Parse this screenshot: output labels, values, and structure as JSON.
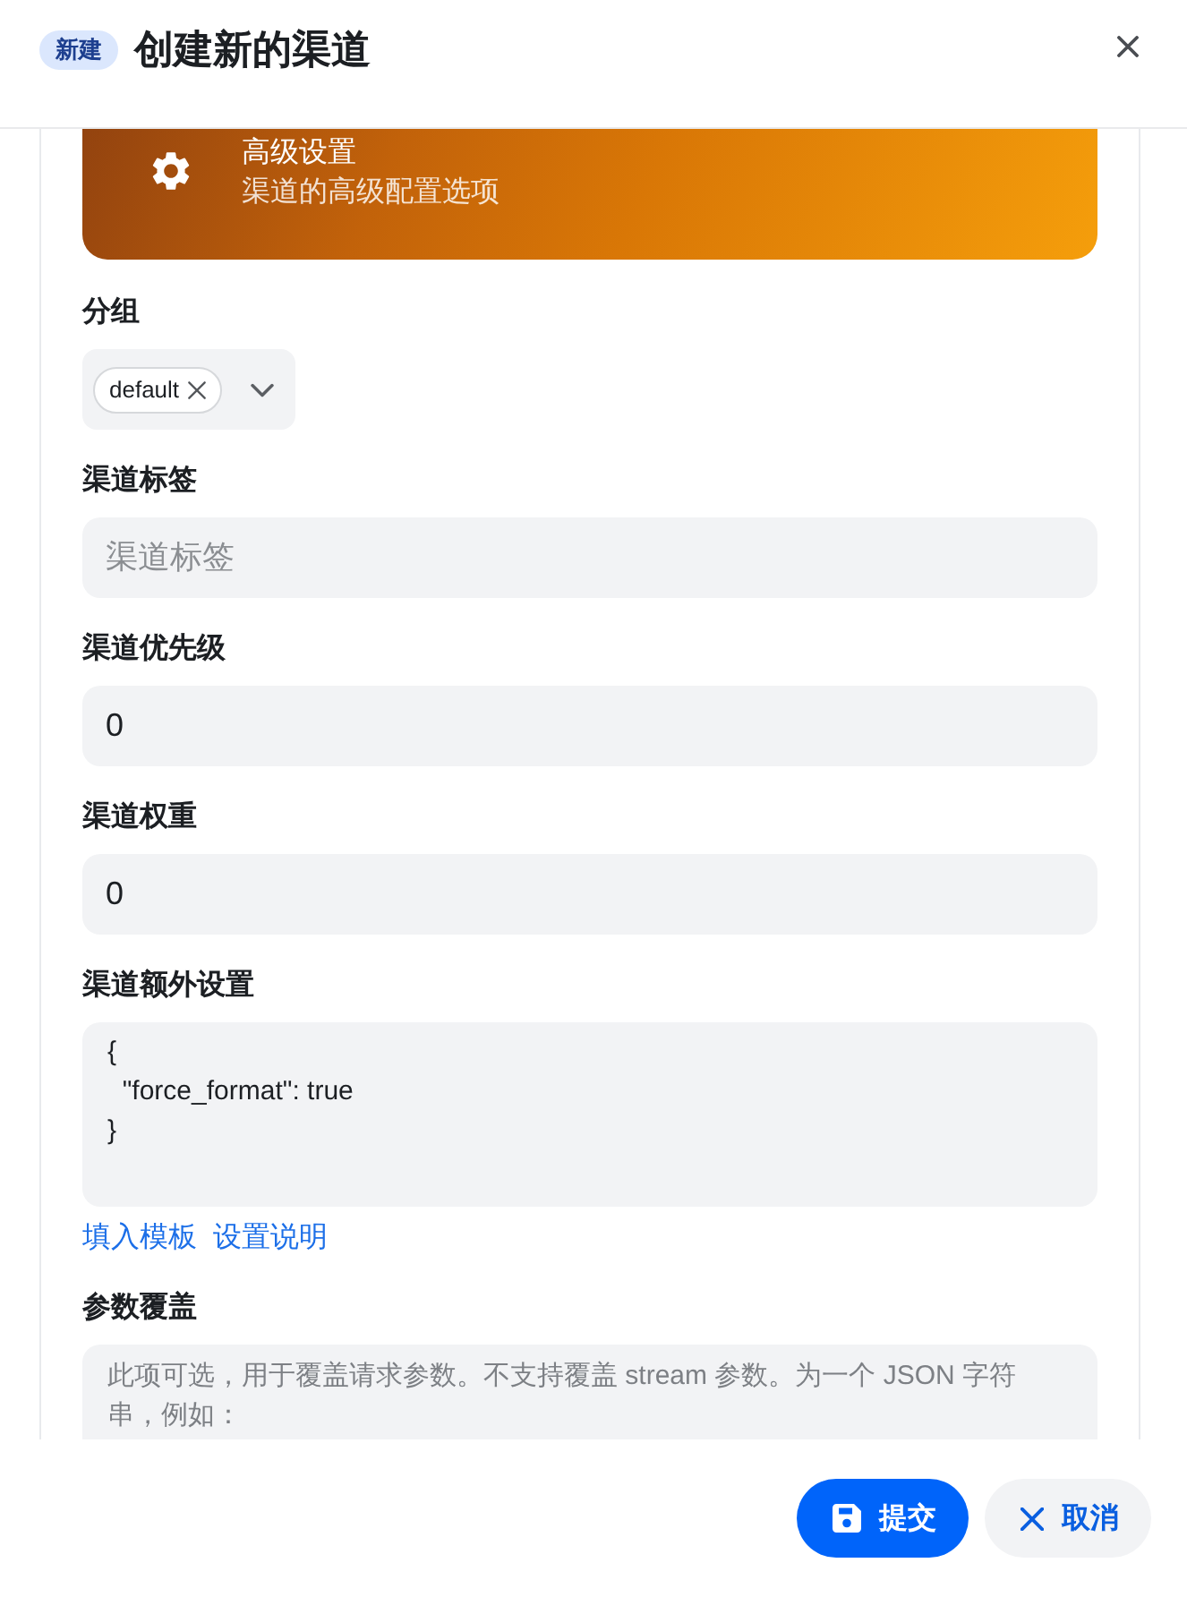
{
  "header": {
    "badge": "新建",
    "title": "创建新的渠道"
  },
  "banner": {
    "title": "高级设置",
    "subtitle": "渠道的高级配置选项"
  },
  "fields": [
    {
      "kind": "tags",
      "label": "分组",
      "tags": [
        "default"
      ]
    },
    {
      "kind": "input",
      "label": "渠道标签",
      "placeholder": "渠道标签"
    },
    {
      "kind": "input",
      "label": "渠道优先级",
      "value": "0"
    },
    {
      "kind": "input",
      "label": "渠道权重",
      "value": "0"
    },
    {
      "kind": "textarea",
      "label": "渠道额外设置",
      "value": "{\n  \"force_format\": true\n}",
      "links": [
        "填入模板",
        "设置说明"
      ]
    },
    {
      "kind": "textarea",
      "label": "参数覆盖",
      "placeholder": "此项可选，用于覆盖请求参数。不支持覆盖 stream 参数。为一个 JSON 字符串，例如："
    }
  ],
  "buttons": [
    {
      "kind": "primary",
      "label": "提交"
    },
    {
      "kind": "secondary",
      "label": "取消"
    }
  ]
}
